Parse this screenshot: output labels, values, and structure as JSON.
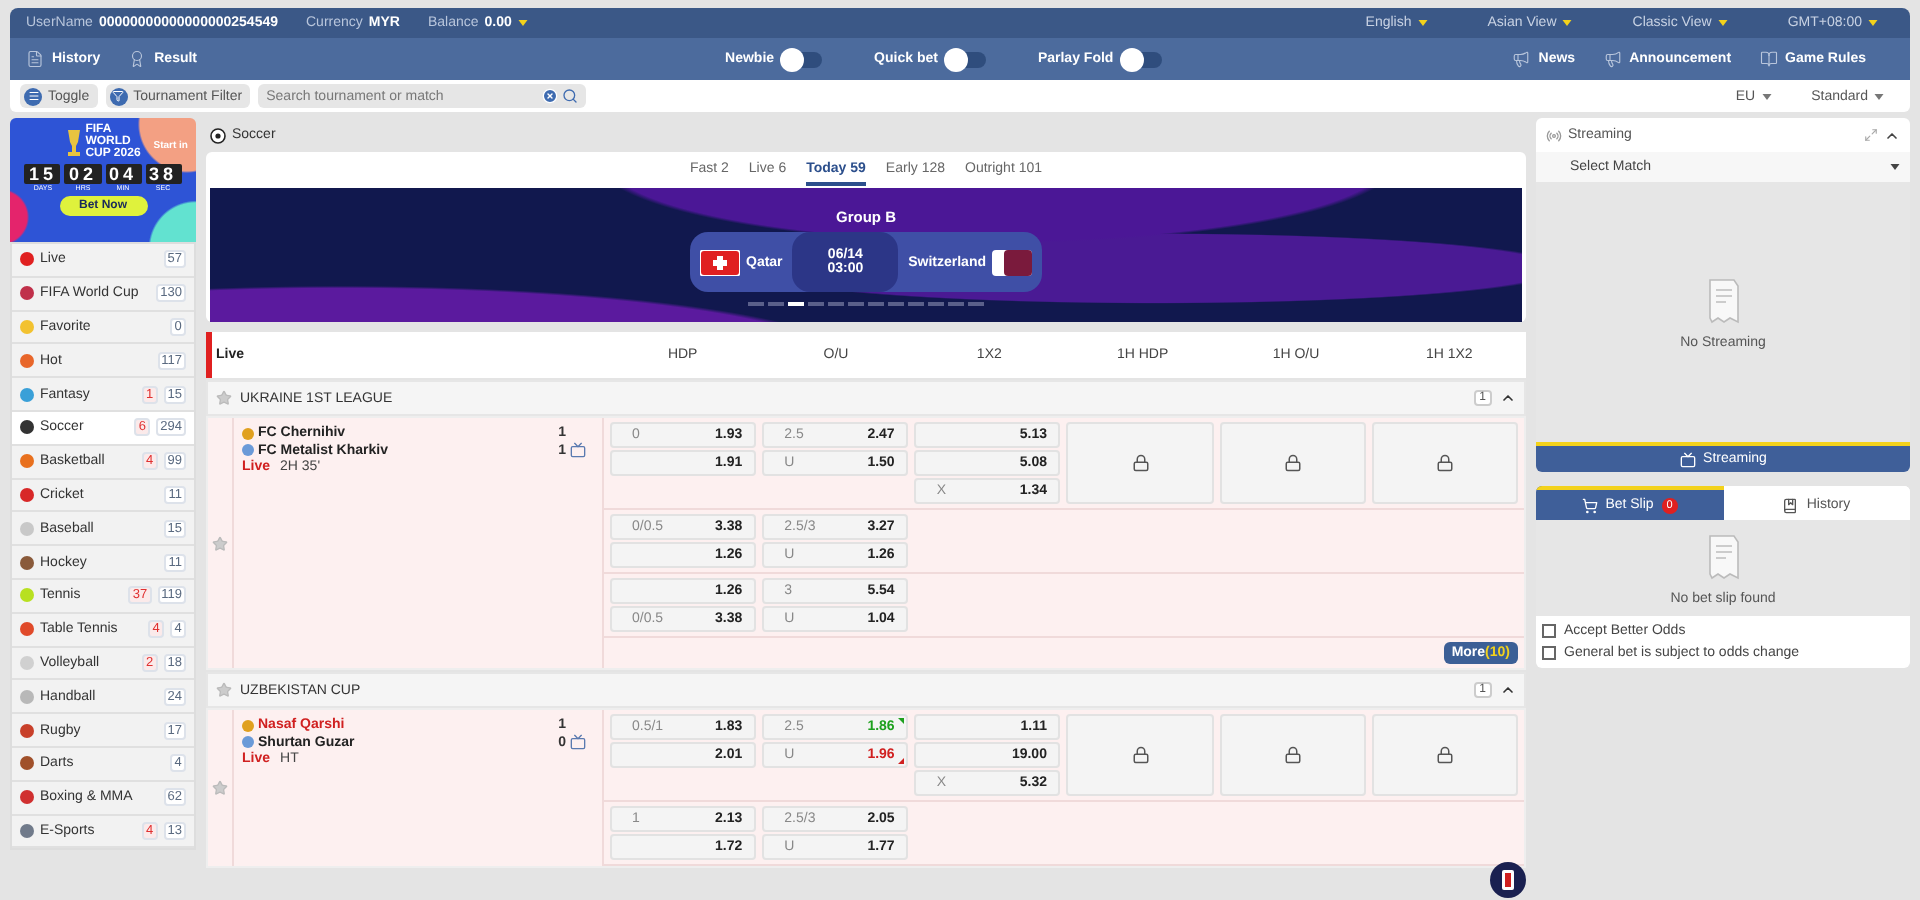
{
  "top_bar": {
    "username_label": "UserName",
    "username": "00000000000000000254549",
    "currency_label": "Currency",
    "currency": "MYR",
    "balance_label": "Balance",
    "balance": "0.00",
    "menus": [
      "English",
      "Asian View",
      "Classic View",
      "GMT+08:00"
    ]
  },
  "nav_bar": {
    "links": [
      "History",
      "Result"
    ],
    "toggles": [
      {
        "label": "Newbie",
        "on": false
      },
      {
        "label": "Quick bet",
        "on": false
      },
      {
        "label": "Parlay Fold",
        "on": false
      }
    ],
    "right_links": [
      "News",
      "Announcement",
      "Game Rules"
    ]
  },
  "filter_bar": {
    "buttons": [
      "Toggle",
      "Tournament Filter"
    ],
    "search": {
      "placeholder": "Search tournament or match"
    },
    "selects": [
      "EU",
      "Standard"
    ]
  },
  "promo": {
    "title_lines": [
      "FIFA",
      "WORLD",
      "CUP 2026"
    ],
    "start_label": "Start in",
    "countdown": [
      {
        "value": "15",
        "unit": "DAYS"
      },
      {
        "value": "02",
        "unit": "HRS"
      },
      {
        "value": "04",
        "unit": "MIN"
      },
      {
        "value": "38",
        "unit": "SEC"
      }
    ],
    "button": "Bet Now"
  },
  "sports": [
    {
      "name": "Live",
      "count": "57",
      "color": "#e02020",
      "selected": false
    },
    {
      "name": "FIFA World Cup",
      "count": "130",
      "color": "#c0304a",
      "selected": false
    },
    {
      "name": "Favorite",
      "count": "0",
      "color": "#f2c230",
      "selected": false
    },
    {
      "name": "Hot",
      "count": "117",
      "color": "#e8662a",
      "selected": false
    },
    {
      "name": "Fantasy",
      "live_count": "1",
      "count": "15",
      "color": "#3aa0d8",
      "selected": false
    },
    {
      "name": "Soccer",
      "live_count": "6",
      "count": "294",
      "color": "#333333",
      "selected": true
    },
    {
      "name": "Basketball",
      "live_count": "4",
      "count": "99",
      "color": "#e8701e",
      "selected": false
    },
    {
      "name": "Cricket",
      "count": "11",
      "color": "#d82828",
      "selected": false
    },
    {
      "name": "Baseball",
      "count": "15",
      "color": "#c8c8c8",
      "selected": false
    },
    {
      "name": "Hockey",
      "count": "11",
      "color": "#8a5a3a",
      "selected": false
    },
    {
      "name": "Tennis",
      "live_count": "37",
      "count": "119",
      "color": "#b8e020",
      "selected": false
    },
    {
      "name": "Table Tennis",
      "live_count": "4",
      "count": "4",
      "color": "#e04a2a",
      "selected": false
    },
    {
      "name": "Volleyball",
      "live_count": "2",
      "count": "18",
      "color": "#d0d0d0",
      "selected": false
    },
    {
      "name": "Handball",
      "count": "24",
      "color": "#b8b8b8",
      "selected": false
    },
    {
      "name": "Rugby",
      "count": "17",
      "color": "#c8402a",
      "selected": false
    },
    {
      "name": "Darts",
      "count": "4",
      "color": "#a0502a",
      "selected": false
    },
    {
      "name": "Boxing & MMA",
      "count": "62",
      "color": "#d03030",
      "selected": false
    },
    {
      "name": "E-Sports",
      "live_count": "4",
      "count": "13",
      "color": "#707a8a",
      "selected": false
    }
  ],
  "soccer": {
    "title": "Soccer",
    "tabs": [
      {
        "label": "Fast 2",
        "selected": false
      },
      {
        "label": "Live 6",
        "selected": false
      },
      {
        "label": "Today 59",
        "selected": true
      },
      {
        "label": "Early 128",
        "selected": false
      },
      {
        "label": "Outright 101",
        "selected": false
      }
    ],
    "featured": {
      "group": "Group B",
      "home": "Qatar",
      "date": "06/14",
      "time": "03:00",
      "away": "Switzerland",
      "slides": [
        {
          "selected": false
        },
        {
          "selected": false
        },
        {
          "selected": true
        },
        {
          "selected": false
        },
        {
          "selected": false
        },
        {
          "selected": false
        },
        {
          "selected": false
        },
        {
          "selected": false
        },
        {
          "selected": false
        },
        {
          "selected": false
        },
        {
          "selected": false
        },
        {
          "selected": false
        }
      ]
    },
    "market_header": {
      "label": "Live",
      "columns": [
        "HDP",
        "O/U",
        "1X2",
        "1H HDP",
        "1H O/U",
        "1H 1X2"
      ]
    },
    "leagues": [
      {
        "name": "UKRAINE 1ST LEAGUE",
        "count": "1",
        "expanded": true,
        "matches": [
          {
            "home": {
              "name": "FC Chernihiv",
              "score": "1",
              "favorite": false
            },
            "away": {
              "name": "FC Metalist Kharkiv",
              "score": "1",
              "favorite": false
            },
            "status": "Live",
            "time": "2H 35'",
            "groups": [
              {
                "locked": true,
                "hdp": [
                  {
                    "line": "0",
                    "odds": "1.93"
                  },
                  {
                    "odds": "1.91"
                  }
                ],
                "ou": [
                  {
                    "line": "2.5",
                    "odds": "2.47"
                  },
                  {
                    "line": "U",
                    "odds": "1.50"
                  }
                ],
                "x12": [
                  {
                    "odds": "5.13"
                  },
                  {
                    "odds": "5.08"
                  },
                  {
                    "line": "X",
                    "odds": "1.34"
                  }
                ]
              },
              {
                "locked": false,
                "hdp": [
                  {
                    "line": "0/0.5",
                    "odds": "3.38"
                  },
                  {
                    "odds": "1.26"
                  }
                ],
                "ou": [
                  {
                    "line": "2.5/3",
                    "odds": "3.27"
                  },
                  {
                    "line": "U",
                    "odds": "1.26"
                  }
                ]
              },
              {
                "locked": false,
                "hdp": [
                  {
                    "odds": "1.26"
                  },
                  {
                    "line": "0/0.5",
                    "odds": "3.38"
                  }
                ],
                "ou": [
                  {
                    "line": "3",
                    "odds": "5.54"
                  },
                  {
                    "line": "U",
                    "odds": "1.04"
                  }
                ]
              }
            ],
            "more": {
              "label": "More",
              "count": "(10)"
            }
          }
        ]
      },
      {
        "name": "UZBEKISTAN CUP",
        "count": "1",
        "expanded": true,
        "matches": [
          {
            "home": {
              "name": "Nasaf Qarshi",
              "score": "1",
              "favorite": true
            },
            "away": {
              "name": "Shurtan Guzar",
              "score": "0",
              "favorite": false
            },
            "status": "Live",
            "time": "HT",
            "groups": [
              {
                "locked": true,
                "hdp": [
                  {
                    "line": "0.5/1",
                    "odds": "1.83"
                  },
                  {
                    "odds": "2.01"
                  }
                ],
                "ou": [
                  {
                    "line": "2.5",
                    "odds": "1.86",
                    "rising": true
                  },
                  {
                    "line": "U",
                    "odds": "1.96",
                    "rising": false
                  }
                ],
                "x12": [
                  {
                    "odds": "1.11"
                  },
                  {
                    "odds": "19.00"
                  },
                  {
                    "line": "X",
                    "odds": "5.32"
                  }
                ]
              },
              {
                "locked": false,
                "hdp": [
                  {
                    "line": "1",
                    "odds": "2.13"
                  },
                  {
                    "odds": "1.72"
                  }
                ],
                "ou": [
                  {
                    "line": "2.5/3",
                    "odds": "2.05"
                  },
                  {
                    "line": "U",
                    "odds": "1.77"
                  }
                ]
              }
            ]
          }
        ]
      }
    ]
  },
  "streaming": {
    "title": "Streaming",
    "select": "Select Match",
    "empty": "No Streaming",
    "button": "Streaming"
  },
  "bet_slip": {
    "tabs": [
      {
        "label": "Bet Slip",
        "badge": "0",
        "selected": true
      },
      {
        "label": "History",
        "selected": false
      }
    ],
    "empty": "No bet slip found",
    "options": [
      {
        "label": "Accept Better Odds",
        "checked": false
      },
      {
        "label": "General bet is subject to odds change",
        "checked": false
      }
    ]
  }
}
